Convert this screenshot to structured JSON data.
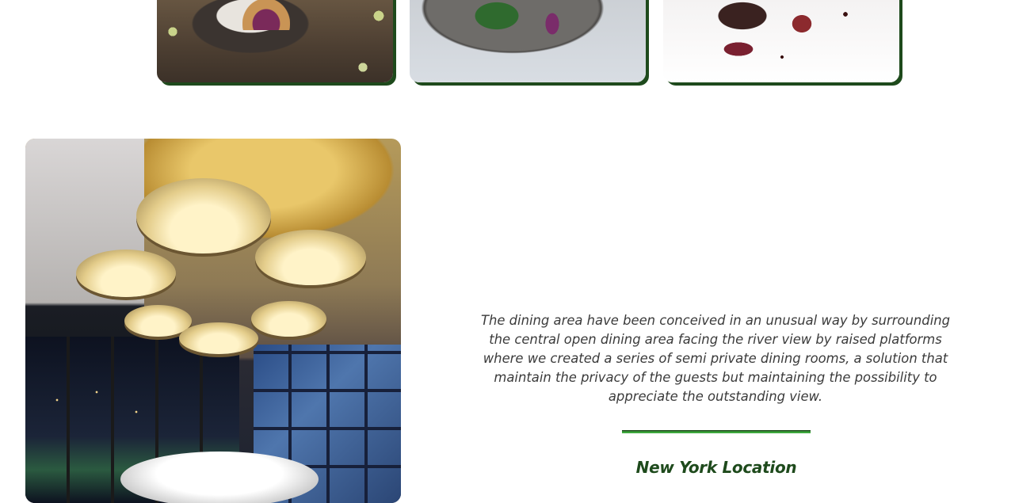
{
  "gallery": {
    "images": [
      {
        "subject": "plated dish with flowers"
      },
      {
        "subject": "plated greens and red onion"
      },
      {
        "subject": "seared meat with sauce"
      }
    ]
  },
  "dining_section": {
    "photo_subject": "private dining room with chandeliers",
    "description": "The dining area have been conceived in an unusual way by surrounding the central open dining area facing the river view by raised platforms where we created a series of semi private dining rooms, a solution that maintain the privacy of the guests but maintaining the possibility to appreciate the outstanding view.",
    "location_title": "New York Location"
  },
  "colors": {
    "brand_dark_green": "#1e4a1c",
    "accent_green": "#3ea93e",
    "text": "#3b3b3b"
  }
}
